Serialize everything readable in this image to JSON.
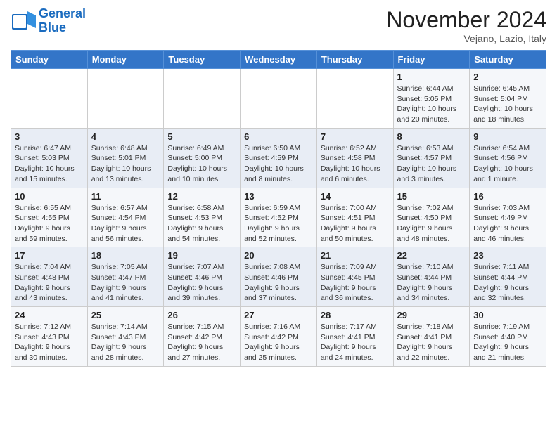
{
  "header": {
    "logo_line1": "General",
    "logo_line2": "Blue",
    "month": "November 2024",
    "location": "Vejano, Lazio, Italy"
  },
  "weekdays": [
    "Sunday",
    "Monday",
    "Tuesday",
    "Wednesday",
    "Thursday",
    "Friday",
    "Saturday"
  ],
  "weeks": [
    [
      {
        "day": "",
        "info": ""
      },
      {
        "day": "",
        "info": ""
      },
      {
        "day": "",
        "info": ""
      },
      {
        "day": "",
        "info": ""
      },
      {
        "day": "",
        "info": ""
      },
      {
        "day": "1",
        "info": "Sunrise: 6:44 AM\nSunset: 5:05 PM\nDaylight: 10 hours\nand 20 minutes."
      },
      {
        "day": "2",
        "info": "Sunrise: 6:45 AM\nSunset: 5:04 PM\nDaylight: 10 hours\nand 18 minutes."
      }
    ],
    [
      {
        "day": "3",
        "info": "Sunrise: 6:47 AM\nSunset: 5:03 PM\nDaylight: 10 hours\nand 15 minutes."
      },
      {
        "day": "4",
        "info": "Sunrise: 6:48 AM\nSunset: 5:01 PM\nDaylight: 10 hours\nand 13 minutes."
      },
      {
        "day": "5",
        "info": "Sunrise: 6:49 AM\nSunset: 5:00 PM\nDaylight: 10 hours\nand 10 minutes."
      },
      {
        "day": "6",
        "info": "Sunrise: 6:50 AM\nSunset: 4:59 PM\nDaylight: 10 hours\nand 8 minutes."
      },
      {
        "day": "7",
        "info": "Sunrise: 6:52 AM\nSunset: 4:58 PM\nDaylight: 10 hours\nand 6 minutes."
      },
      {
        "day": "8",
        "info": "Sunrise: 6:53 AM\nSunset: 4:57 PM\nDaylight: 10 hours\nand 3 minutes."
      },
      {
        "day": "9",
        "info": "Sunrise: 6:54 AM\nSunset: 4:56 PM\nDaylight: 10 hours\nand 1 minute."
      }
    ],
    [
      {
        "day": "10",
        "info": "Sunrise: 6:55 AM\nSunset: 4:55 PM\nDaylight: 9 hours\nand 59 minutes."
      },
      {
        "day": "11",
        "info": "Sunrise: 6:57 AM\nSunset: 4:54 PM\nDaylight: 9 hours\nand 56 minutes."
      },
      {
        "day": "12",
        "info": "Sunrise: 6:58 AM\nSunset: 4:53 PM\nDaylight: 9 hours\nand 54 minutes."
      },
      {
        "day": "13",
        "info": "Sunrise: 6:59 AM\nSunset: 4:52 PM\nDaylight: 9 hours\nand 52 minutes."
      },
      {
        "day": "14",
        "info": "Sunrise: 7:00 AM\nSunset: 4:51 PM\nDaylight: 9 hours\nand 50 minutes."
      },
      {
        "day": "15",
        "info": "Sunrise: 7:02 AM\nSunset: 4:50 PM\nDaylight: 9 hours\nand 48 minutes."
      },
      {
        "day": "16",
        "info": "Sunrise: 7:03 AM\nSunset: 4:49 PM\nDaylight: 9 hours\nand 46 minutes."
      }
    ],
    [
      {
        "day": "17",
        "info": "Sunrise: 7:04 AM\nSunset: 4:48 PM\nDaylight: 9 hours\nand 43 minutes."
      },
      {
        "day": "18",
        "info": "Sunrise: 7:05 AM\nSunset: 4:47 PM\nDaylight: 9 hours\nand 41 minutes."
      },
      {
        "day": "19",
        "info": "Sunrise: 7:07 AM\nSunset: 4:46 PM\nDaylight: 9 hours\nand 39 minutes."
      },
      {
        "day": "20",
        "info": "Sunrise: 7:08 AM\nSunset: 4:46 PM\nDaylight: 9 hours\nand 37 minutes."
      },
      {
        "day": "21",
        "info": "Sunrise: 7:09 AM\nSunset: 4:45 PM\nDaylight: 9 hours\nand 36 minutes."
      },
      {
        "day": "22",
        "info": "Sunrise: 7:10 AM\nSunset: 4:44 PM\nDaylight: 9 hours\nand 34 minutes."
      },
      {
        "day": "23",
        "info": "Sunrise: 7:11 AM\nSunset: 4:44 PM\nDaylight: 9 hours\nand 32 minutes."
      }
    ],
    [
      {
        "day": "24",
        "info": "Sunrise: 7:12 AM\nSunset: 4:43 PM\nDaylight: 9 hours\nand 30 minutes."
      },
      {
        "day": "25",
        "info": "Sunrise: 7:14 AM\nSunset: 4:43 PM\nDaylight: 9 hours\nand 28 minutes."
      },
      {
        "day": "26",
        "info": "Sunrise: 7:15 AM\nSunset: 4:42 PM\nDaylight: 9 hours\nand 27 minutes."
      },
      {
        "day": "27",
        "info": "Sunrise: 7:16 AM\nSunset: 4:42 PM\nDaylight: 9 hours\nand 25 minutes."
      },
      {
        "day": "28",
        "info": "Sunrise: 7:17 AM\nSunset: 4:41 PM\nDaylight: 9 hours\nand 24 minutes."
      },
      {
        "day": "29",
        "info": "Sunrise: 7:18 AM\nSunset: 4:41 PM\nDaylight: 9 hours\nand 22 minutes."
      },
      {
        "day": "30",
        "info": "Sunrise: 7:19 AM\nSunset: 4:40 PM\nDaylight: 9 hours\nand 21 minutes."
      }
    ]
  ]
}
